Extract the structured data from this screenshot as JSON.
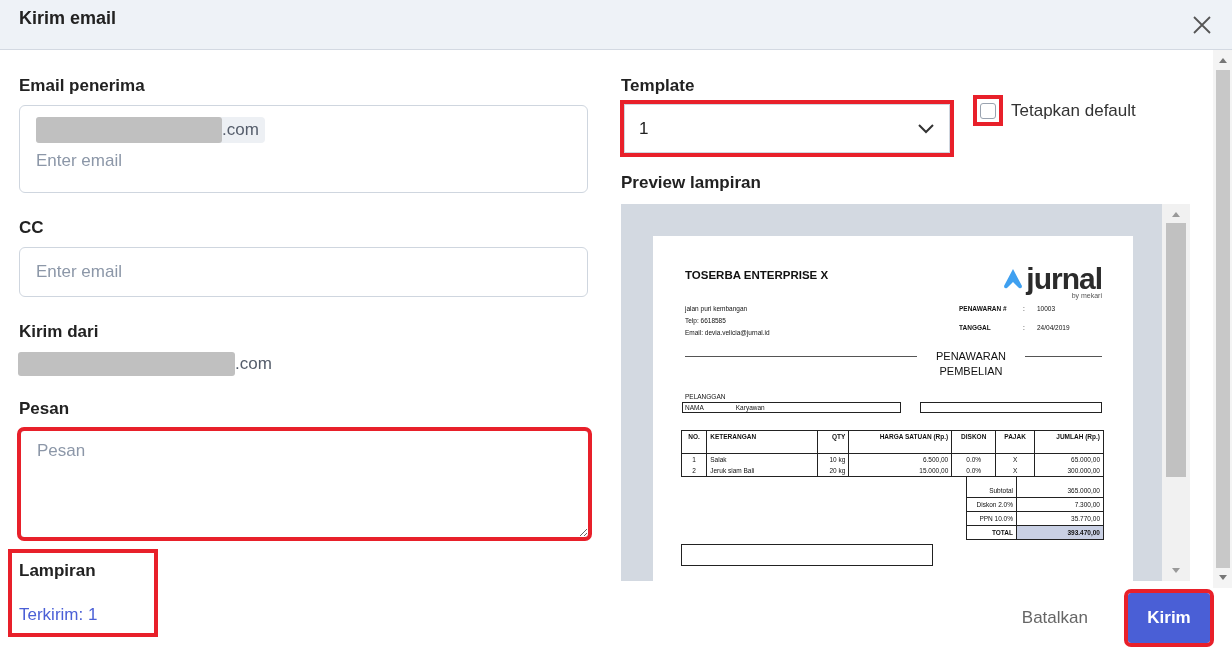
{
  "dialog": {
    "title": "Kirim email"
  },
  "recipient": {
    "label": "Email penerima",
    "chips": [
      {
        "text": ".com",
        "redacted": true
      }
    ],
    "placeholder": "Enter email"
  },
  "cc": {
    "label": "CC",
    "placeholder": "Enter email"
  },
  "sender": {
    "label": "Kirim dari",
    "value": ".com",
    "redacted": true
  },
  "message": {
    "label": "Pesan",
    "placeholder": "Pesan",
    "highlighted": true
  },
  "attachment": {
    "label": "Lampiran",
    "link": "Terkirim: 1",
    "highlighted": true
  },
  "template": {
    "label": "Template",
    "value": "1",
    "highlighted": true
  },
  "set_default": {
    "label": "Tetapkan default",
    "checked": false,
    "highlighted": true
  },
  "preview": {
    "label": "Preview lampiran",
    "document": {
      "company": "TOSERBA ENTERPRISE X",
      "logo": {
        "name": "jurnal",
        "tagline": "by mekari"
      },
      "address_lines": [
        "jalan puri kembangan",
        "Telp: 6618585",
        "Email: devia.velicia@jurnal.id"
      ],
      "meta_separator": ":",
      "meta": [
        {
          "label": "PENAWARAN #",
          "value": "10003"
        },
        {
          "label": "TANGGAL",
          "value": "24/04/2019"
        }
      ],
      "title_lines": [
        "PENAWARAN",
        "PEMBELIAN"
      ],
      "customer": {
        "label": "PELANGGAN",
        "name_label": "NAMA",
        "name": "Karyawan"
      },
      "columns": [
        "NO.",
        "KETERANGAN",
        "QTY",
        "HARGA SATUAN (Rp.)",
        "DISKON",
        "PAJAK",
        "JUMLAH (Rp.)"
      ],
      "rows": [
        [
          "1",
          "Salak",
          "10 kg",
          "6.500,00",
          "0.0%",
          "X",
          "65.000,00"
        ],
        [
          "2",
          "Jeruk siam Bali",
          "20 kg",
          "15.000,00",
          "0.0%",
          "X",
          "300.000,00"
        ]
      ],
      "totals": [
        {
          "label": "Subtotal",
          "value": "365.000,00",
          "kind": "plain"
        },
        {
          "label": "Diskon 2.0%",
          "value": "7.300,00",
          "kind": "plain"
        },
        {
          "label": "PPN 10.0%",
          "value": "35.770,00",
          "kind": "plain"
        },
        {
          "label": "TOTAL",
          "value": "393.470,00",
          "kind": "total"
        }
      ]
    }
  },
  "buttons": [
    {
      "label": "Batalkan",
      "kind": "secondary",
      "highlighted": false
    },
    {
      "label": "Kirim",
      "kind": "primary",
      "highlighted": true
    }
  ]
}
